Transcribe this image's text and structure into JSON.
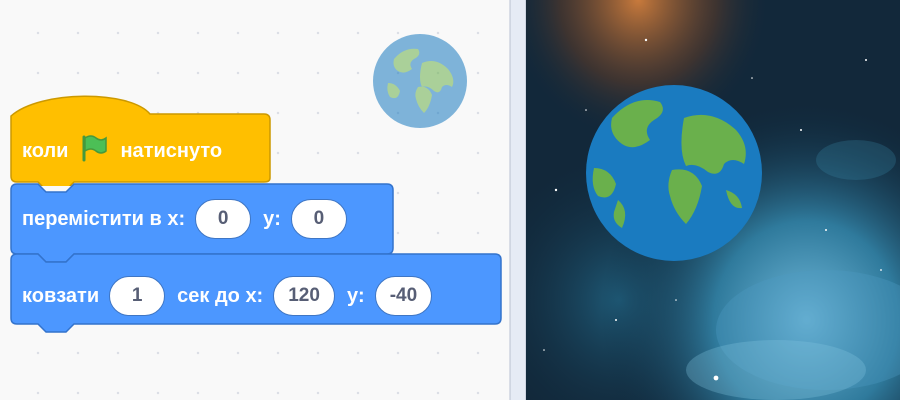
{
  "script": {
    "hat": {
      "text_before": "коли",
      "flag_icon": "green-flag-icon",
      "text_after": "натиснуто",
      "color": "#ffbf00",
      "border": "#cc9900"
    },
    "move": {
      "label": "перемістити в x:",
      "x_value": "0",
      "y_label": "y:",
      "y_value": "0",
      "color": "#4c97ff",
      "border": "#3373cc"
    },
    "glide": {
      "label": "ковзати",
      "secs_value": "1",
      "secs_label": "сек до x:",
      "x_value": "120",
      "y_label": "y:",
      "y_value": "-40",
      "color": "#4c97ff",
      "border": "#3373cc"
    }
  },
  "sprite": {
    "name_icon": "earth-icon"
  },
  "stage": {
    "backdrop_icon": "nebula-backdrop"
  }
}
